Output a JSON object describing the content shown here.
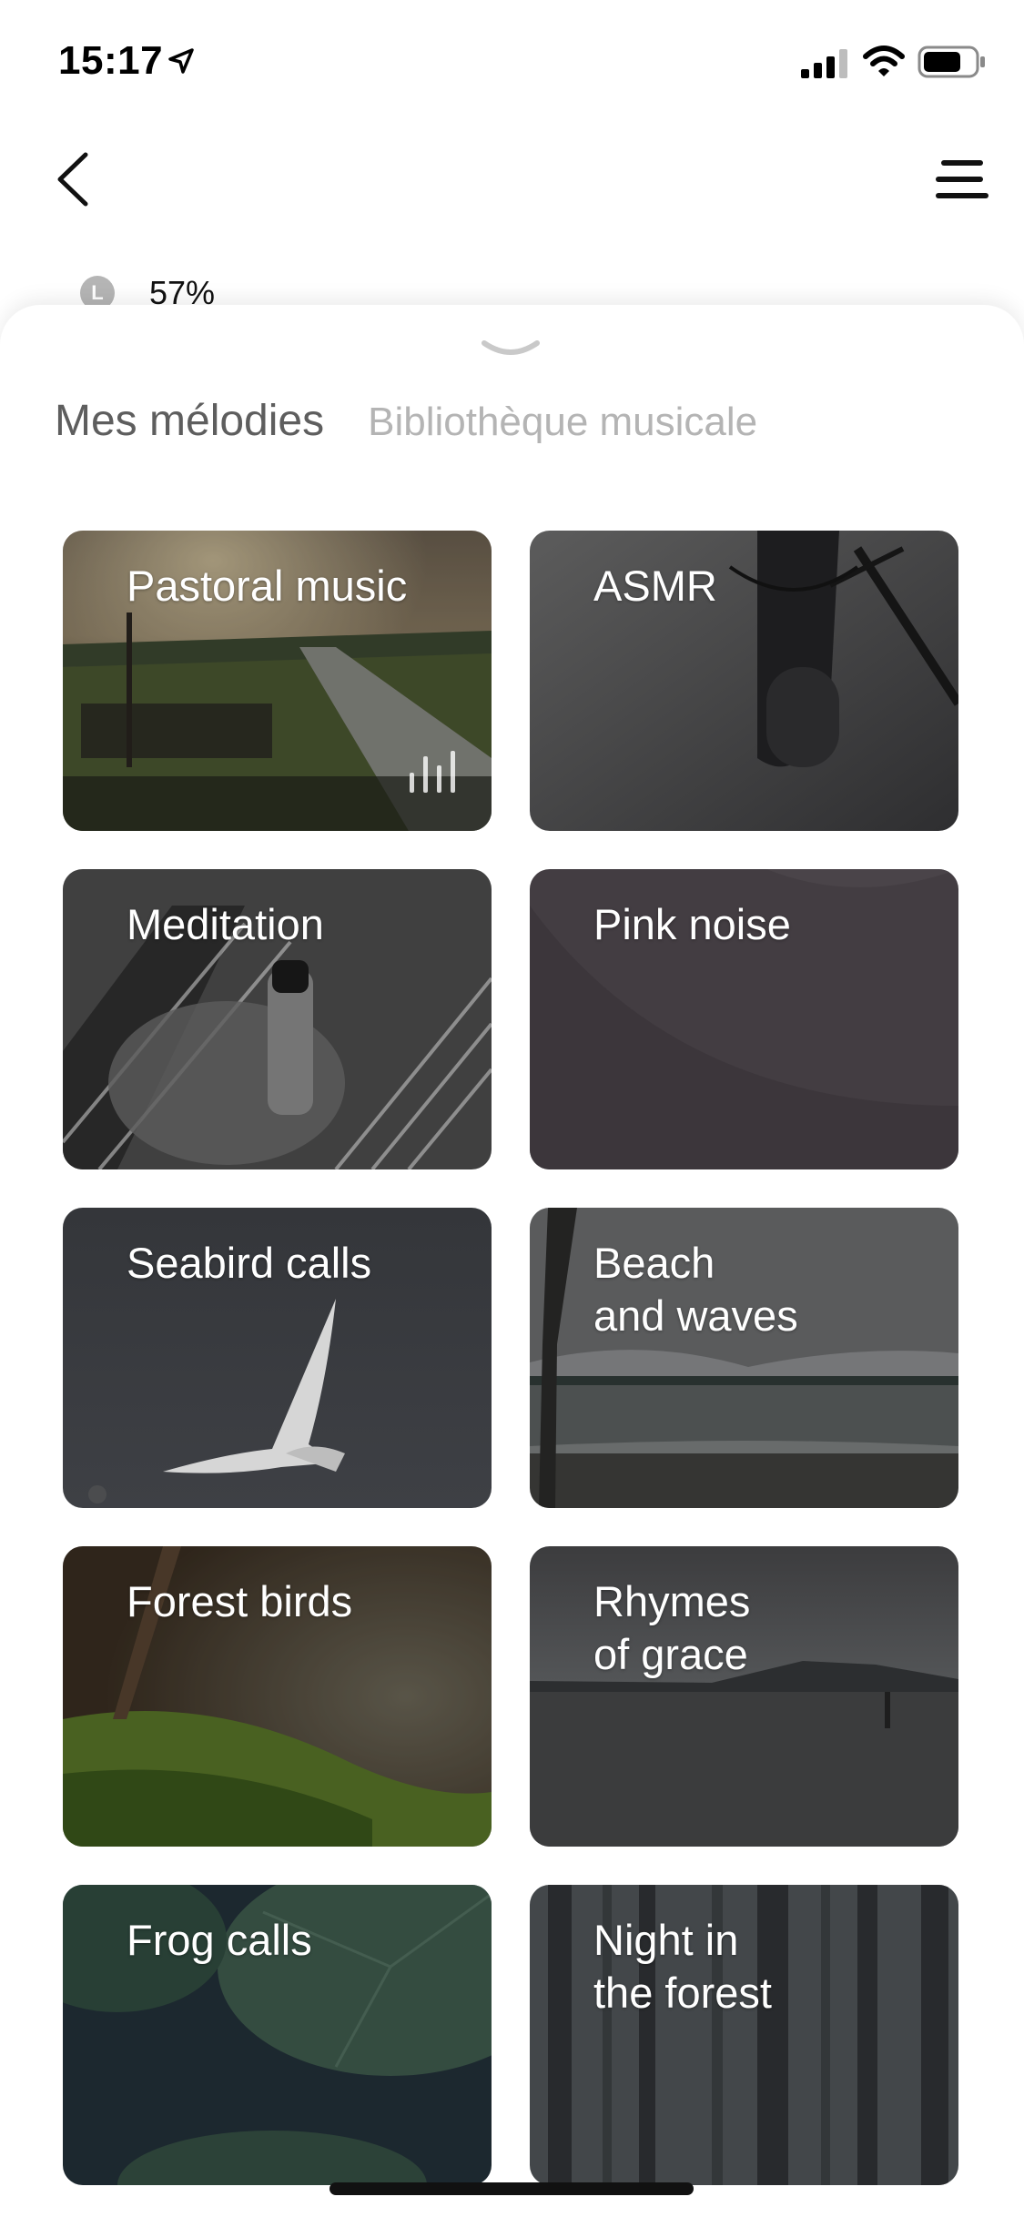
{
  "status_bar": {
    "time": "15:17"
  },
  "nav": {
    "back_icon": "chevron-left-icon",
    "menu_icon": "hamburger-menu-icon"
  },
  "battery_level": {
    "badge": "L",
    "value": "57%"
  },
  "tabs": {
    "active": "Mes mélodies",
    "inactive": "Bibliothèque musicale"
  },
  "melodies": [
    {
      "label": "Pastoral music",
      "playing": true,
      "theme": "pastoral"
    },
    {
      "label": "ASMR",
      "playing": false,
      "theme": "asmr"
    },
    {
      "label": "Meditation",
      "playing": false,
      "theme": "meditation"
    },
    {
      "label": "Pink noise",
      "playing": false,
      "theme": "pinknoise"
    },
    {
      "label": "Seabird calls",
      "playing": false,
      "theme": "seabird"
    },
    {
      "label": "Beach\nand waves",
      "playing": false,
      "theme": "beach"
    },
    {
      "label": "Forest birds",
      "playing": false,
      "theme": "forestbirds"
    },
    {
      "label": "Rhymes\nof grace",
      "playing": false,
      "theme": "rhymes"
    },
    {
      "label": "Frog calls",
      "playing": false,
      "theme": "frog"
    },
    {
      "label": "Night in\nthe forest",
      "playing": false,
      "theme": "nightforest"
    }
  ],
  "colors": {
    "tab_active": "#5e5e5e",
    "tab_inactive": "#b4b4b4",
    "card_text": "#ffffff"
  }
}
